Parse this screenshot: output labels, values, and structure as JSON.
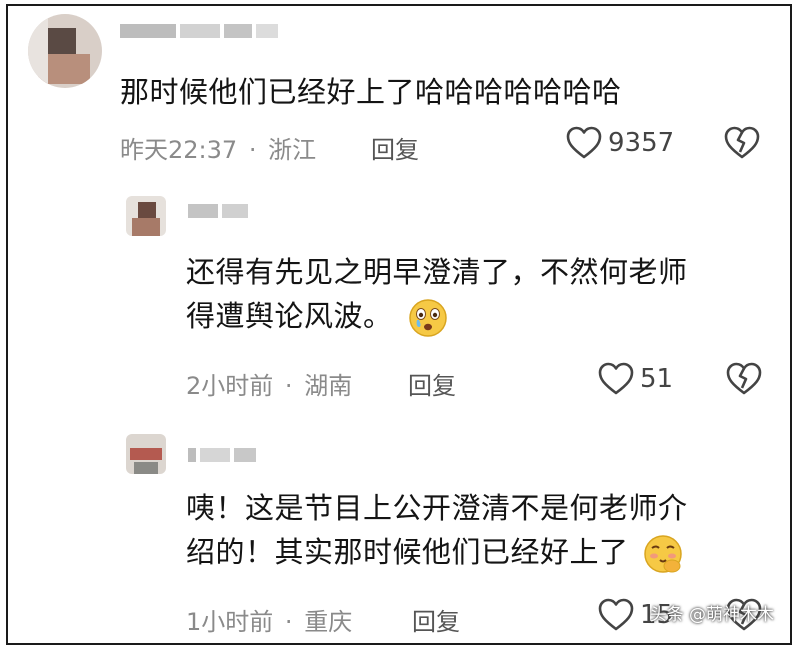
{
  "comments": [
    {
      "text": "那时候他们已经好上了哈哈哈哈哈哈哈",
      "time": "昨天22:37",
      "sep": "·",
      "location": "浙江",
      "reply_label": "回复",
      "likes": "9357"
    },
    {
      "text_line1": "还得有先见之明早澄清了，不然何老师",
      "text_line2": "得遭舆论风波。",
      "emoji": "crying-face",
      "time": "2小时前",
      "sep": "·",
      "location": "湖南",
      "reply_label": "回复",
      "likes": "51"
    },
    {
      "text_line1": "咦！这是节目上公开澄清不是何老师介",
      "text_line2": "绍的！其实那时候他们已经好上了",
      "emoji": "blushing-face",
      "time": "1小时前",
      "sep": "·",
      "location": "重庆",
      "reply_label": "回复",
      "likes": "15"
    }
  ],
  "watermark": "头条 @萌神木木",
  "colors": {
    "meta": "#8a8a8a",
    "text": "#141414",
    "border": "#1a1a1a"
  }
}
